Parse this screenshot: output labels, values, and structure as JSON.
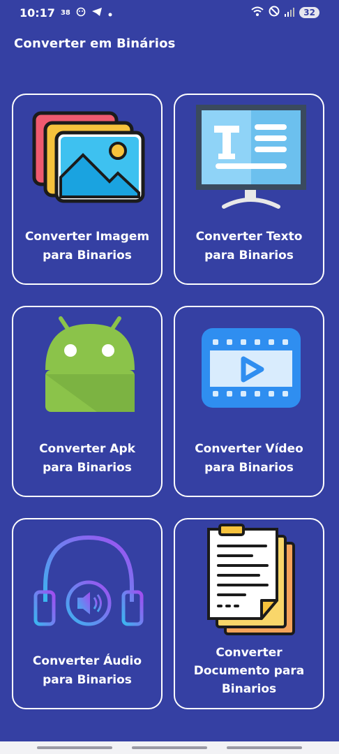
{
  "status_bar": {
    "time": "10:17",
    "small_num": "38",
    "battery": "32"
  },
  "app": {
    "title": "Converter em Binários"
  },
  "cards": [
    {
      "label": "Converter Imagem\npara Binarios",
      "icon": "image-icon"
    },
    {
      "label": "Converter Texto\npara Binarios",
      "icon": "text-document-icon"
    },
    {
      "label": "Converter Apk\npara Binarios",
      "icon": "android-icon"
    },
    {
      "label": "Converter Vídeo\npara Binarios",
      "icon": "video-icon"
    },
    {
      "label": "Converter Áudio\npara Binarios",
      "icon": "headphones-icon"
    },
    {
      "label": "Converter\nDocumento para\nBinarios",
      "icon": "document-icon"
    }
  ],
  "colors": {
    "background": "#3540a3",
    "card_border": "#ffffff"
  }
}
